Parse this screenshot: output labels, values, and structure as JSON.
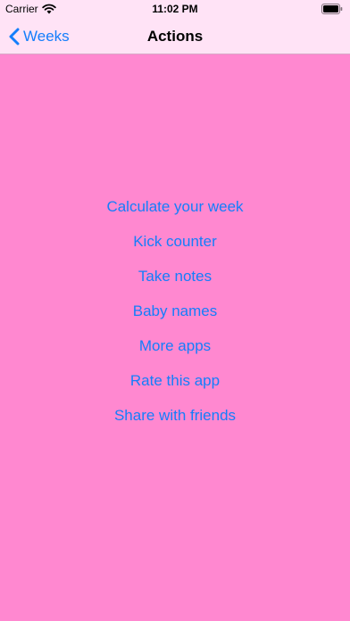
{
  "status_bar": {
    "carrier": "Carrier",
    "time": "11:02 PM",
    "icons": [
      "wifi-icon",
      "battery-icon"
    ]
  },
  "nav": {
    "back_label": "Weeks",
    "title": "Actions",
    "back_icon": "chevron-left-icon"
  },
  "actions": [
    {
      "label": "Calculate your week"
    },
    {
      "label": "Kick counter"
    },
    {
      "label": "Take notes"
    },
    {
      "label": "Baby names"
    },
    {
      "label": "More apps"
    },
    {
      "label": "Rate this app"
    },
    {
      "label": "Share with friends"
    }
  ],
  "colors": {
    "background": "#ff88d0",
    "bar_background": "#ffe3f6",
    "accent": "#147efb"
  }
}
